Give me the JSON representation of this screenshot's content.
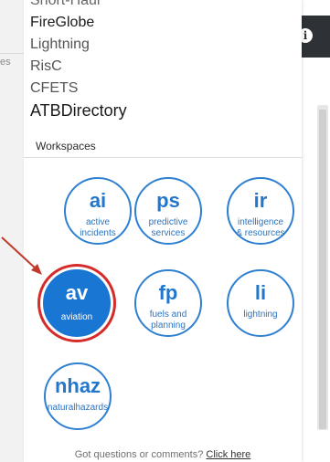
{
  "menu_items": [
    "Short-Haul",
    "FireGlobe",
    "Lightning",
    "RisC",
    "CFETS",
    "ATBDirectory"
  ],
  "background": {
    "left_fragment": "es"
  },
  "info_button": {
    "icon": "info-icon",
    "glyph": "i"
  },
  "workspaces_heading": "Workspaces",
  "workspaces": [
    {
      "abbr": "ai",
      "name": "active incidents",
      "name_l1": "active",
      "name_l2": "incidents",
      "selected": false
    },
    {
      "abbr": "ps",
      "name": "predictive services",
      "name_l1": "predictive",
      "name_l2": "services",
      "selected": false
    },
    {
      "abbr": "ir",
      "name": "intelligence & resources",
      "name_l1": "intelligence",
      "name_l2": "& resources",
      "selected": false
    },
    {
      "abbr": "av",
      "name": "aviation",
      "name_l1": "aviation",
      "name_l2": "",
      "selected": true
    },
    {
      "abbr": "fp",
      "name": "fuels and planning",
      "name_l1": "fuels and",
      "name_l2": "planning",
      "selected": false
    },
    {
      "abbr": "li",
      "name": "lightning",
      "name_l1": "lightning",
      "name_l2": "",
      "selected": false
    },
    {
      "abbr": "nhaz",
      "name": "naturalhazards",
      "name_l1": "naturalhazards",
      "name_l2": "",
      "selected": false
    }
  ],
  "footer": {
    "text": "Got questions or comments?",
    "link": "Click here"
  },
  "colors": {
    "accent": "#1976d2",
    "highlight_ring": "#d62b2b",
    "annotation_arrow": "#c0392b"
  }
}
